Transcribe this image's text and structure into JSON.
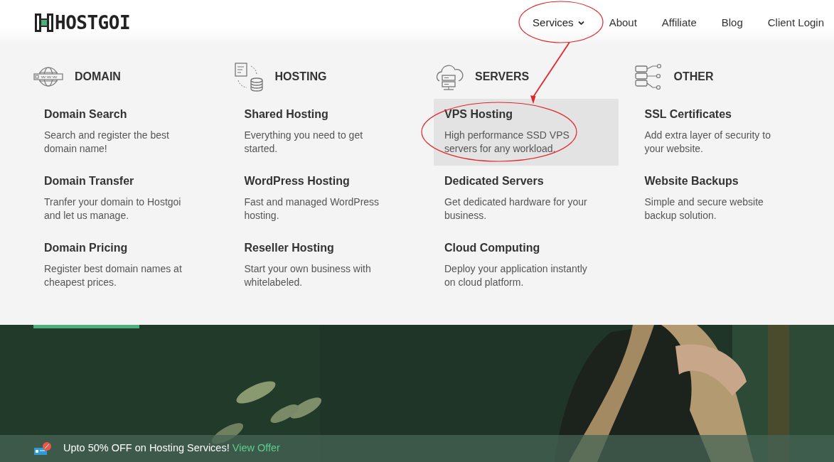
{
  "brand": {
    "name": "HOSTGOI"
  },
  "nav": [
    {
      "label": "Services",
      "has_dropdown": true,
      "expanded": true,
      "circled": true
    },
    {
      "label": "About",
      "has_dropdown": false,
      "expanded": false,
      "circled": false
    },
    {
      "label": "Affiliate",
      "has_dropdown": false,
      "expanded": false,
      "circled": false
    },
    {
      "label": "Blog",
      "has_dropdown": false,
      "expanded": false,
      "circled": false
    },
    {
      "label": "Client Login",
      "has_dropdown": false,
      "expanded": false,
      "circled": false
    }
  ],
  "mega_menu": {
    "columns": [
      {
        "heading": "DOMAIN",
        "items": [
          {
            "title": "Domain Search",
            "description": "Search and register the best domain name!",
            "highlighted": false,
            "circled": false
          },
          {
            "title": "Domain Transfer",
            "description": "Tranfer your domain to Hostgoi and let us manage.",
            "highlighted": false,
            "circled": false
          },
          {
            "title": "Domain Pricing",
            "description": "Register best domain names at cheapest prices.",
            "highlighted": false,
            "circled": false
          }
        ]
      },
      {
        "heading": "HOSTING",
        "items": [
          {
            "title": "Shared Hosting",
            "description": "Everything you need to get started.",
            "highlighted": false,
            "circled": false
          },
          {
            "title": "WordPress Hosting",
            "description": "Fast and managed WordPress hosting.",
            "highlighted": false,
            "circled": false
          },
          {
            "title": "Reseller Hosting",
            "description": "Start your own business with whitelabeled.",
            "highlighted": false,
            "circled": false
          }
        ]
      },
      {
        "heading": "SERVERS",
        "items": [
          {
            "title": "VPS Hosting",
            "description": "High performance SSD VPS servers for any workload.",
            "highlighted": true,
            "circled": true
          },
          {
            "title": "Dedicated Servers",
            "description": "Get dedicated hardware for your business.",
            "highlighted": false,
            "circled": false
          },
          {
            "title": "Cloud Computing",
            "description": "Deploy your application instantly on cloud platform.",
            "highlighted": false,
            "circled": false
          }
        ]
      },
      {
        "heading": "OTHER",
        "items": [
          {
            "title": "SSL Certificates",
            "description": "Add extra layer of security to your website.",
            "highlighted": false,
            "circled": false
          },
          {
            "title": "Website Backups",
            "description": "Simple and secure website backup solution.",
            "highlighted": false,
            "circled": false
          }
        ]
      }
    ]
  },
  "offer_bar": {
    "text": "Upto 50% OFF on Hosting Services!",
    "link": "View Offer"
  },
  "annotation": {
    "arrow": true
  }
}
